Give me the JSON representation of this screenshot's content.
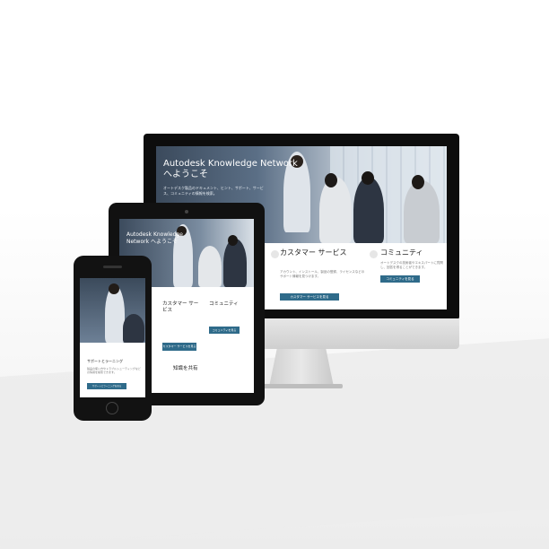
{
  "imac": {
    "hero_title_line1": "Autodesk Knowledge Network",
    "hero_title_line2": "へようこそ",
    "hero_sub": "オートデスク製品のドキュメント、ヒント、サポート、サービス、コミュニティの情報を検索。",
    "card1_title": "カスタマー サービス",
    "card1_text": "アカウント、インストール、製品の登録、ライセンスなどのサポート情報を見つけます。",
    "card1_btn": "カスタマー サービスを見る",
    "card2_title": "コミュニティ",
    "card2_text": "オートデスクの技術者やエキスパートに質問し、回答を得ることができます。",
    "card2_btn": "コミュニティを見る"
  },
  "tablet": {
    "hero_title_line1": "Autodesk Knowledge",
    "hero_title_line2": "Network へようこそ",
    "card1_title": "カスタマー サービス",
    "card2_title": "コミュニティ",
    "card1_btn": "カスタマー サービスを見る",
    "card2_btn": "コミュニティを見る",
    "section_title": "知識を共有"
  },
  "phone": {
    "card_title": "サポートとラーニング",
    "card_text": "製品の使い方やトラブルシューティングなどの情報を検索できます。",
    "card_btn": "サポートとラーニングを見る"
  },
  "colors": {
    "accent": "#2f6b8a",
    "bezel": "#111111"
  },
  "icons": [
    "apple-logo-icon",
    "customer-service-icon",
    "community-icon"
  ]
}
